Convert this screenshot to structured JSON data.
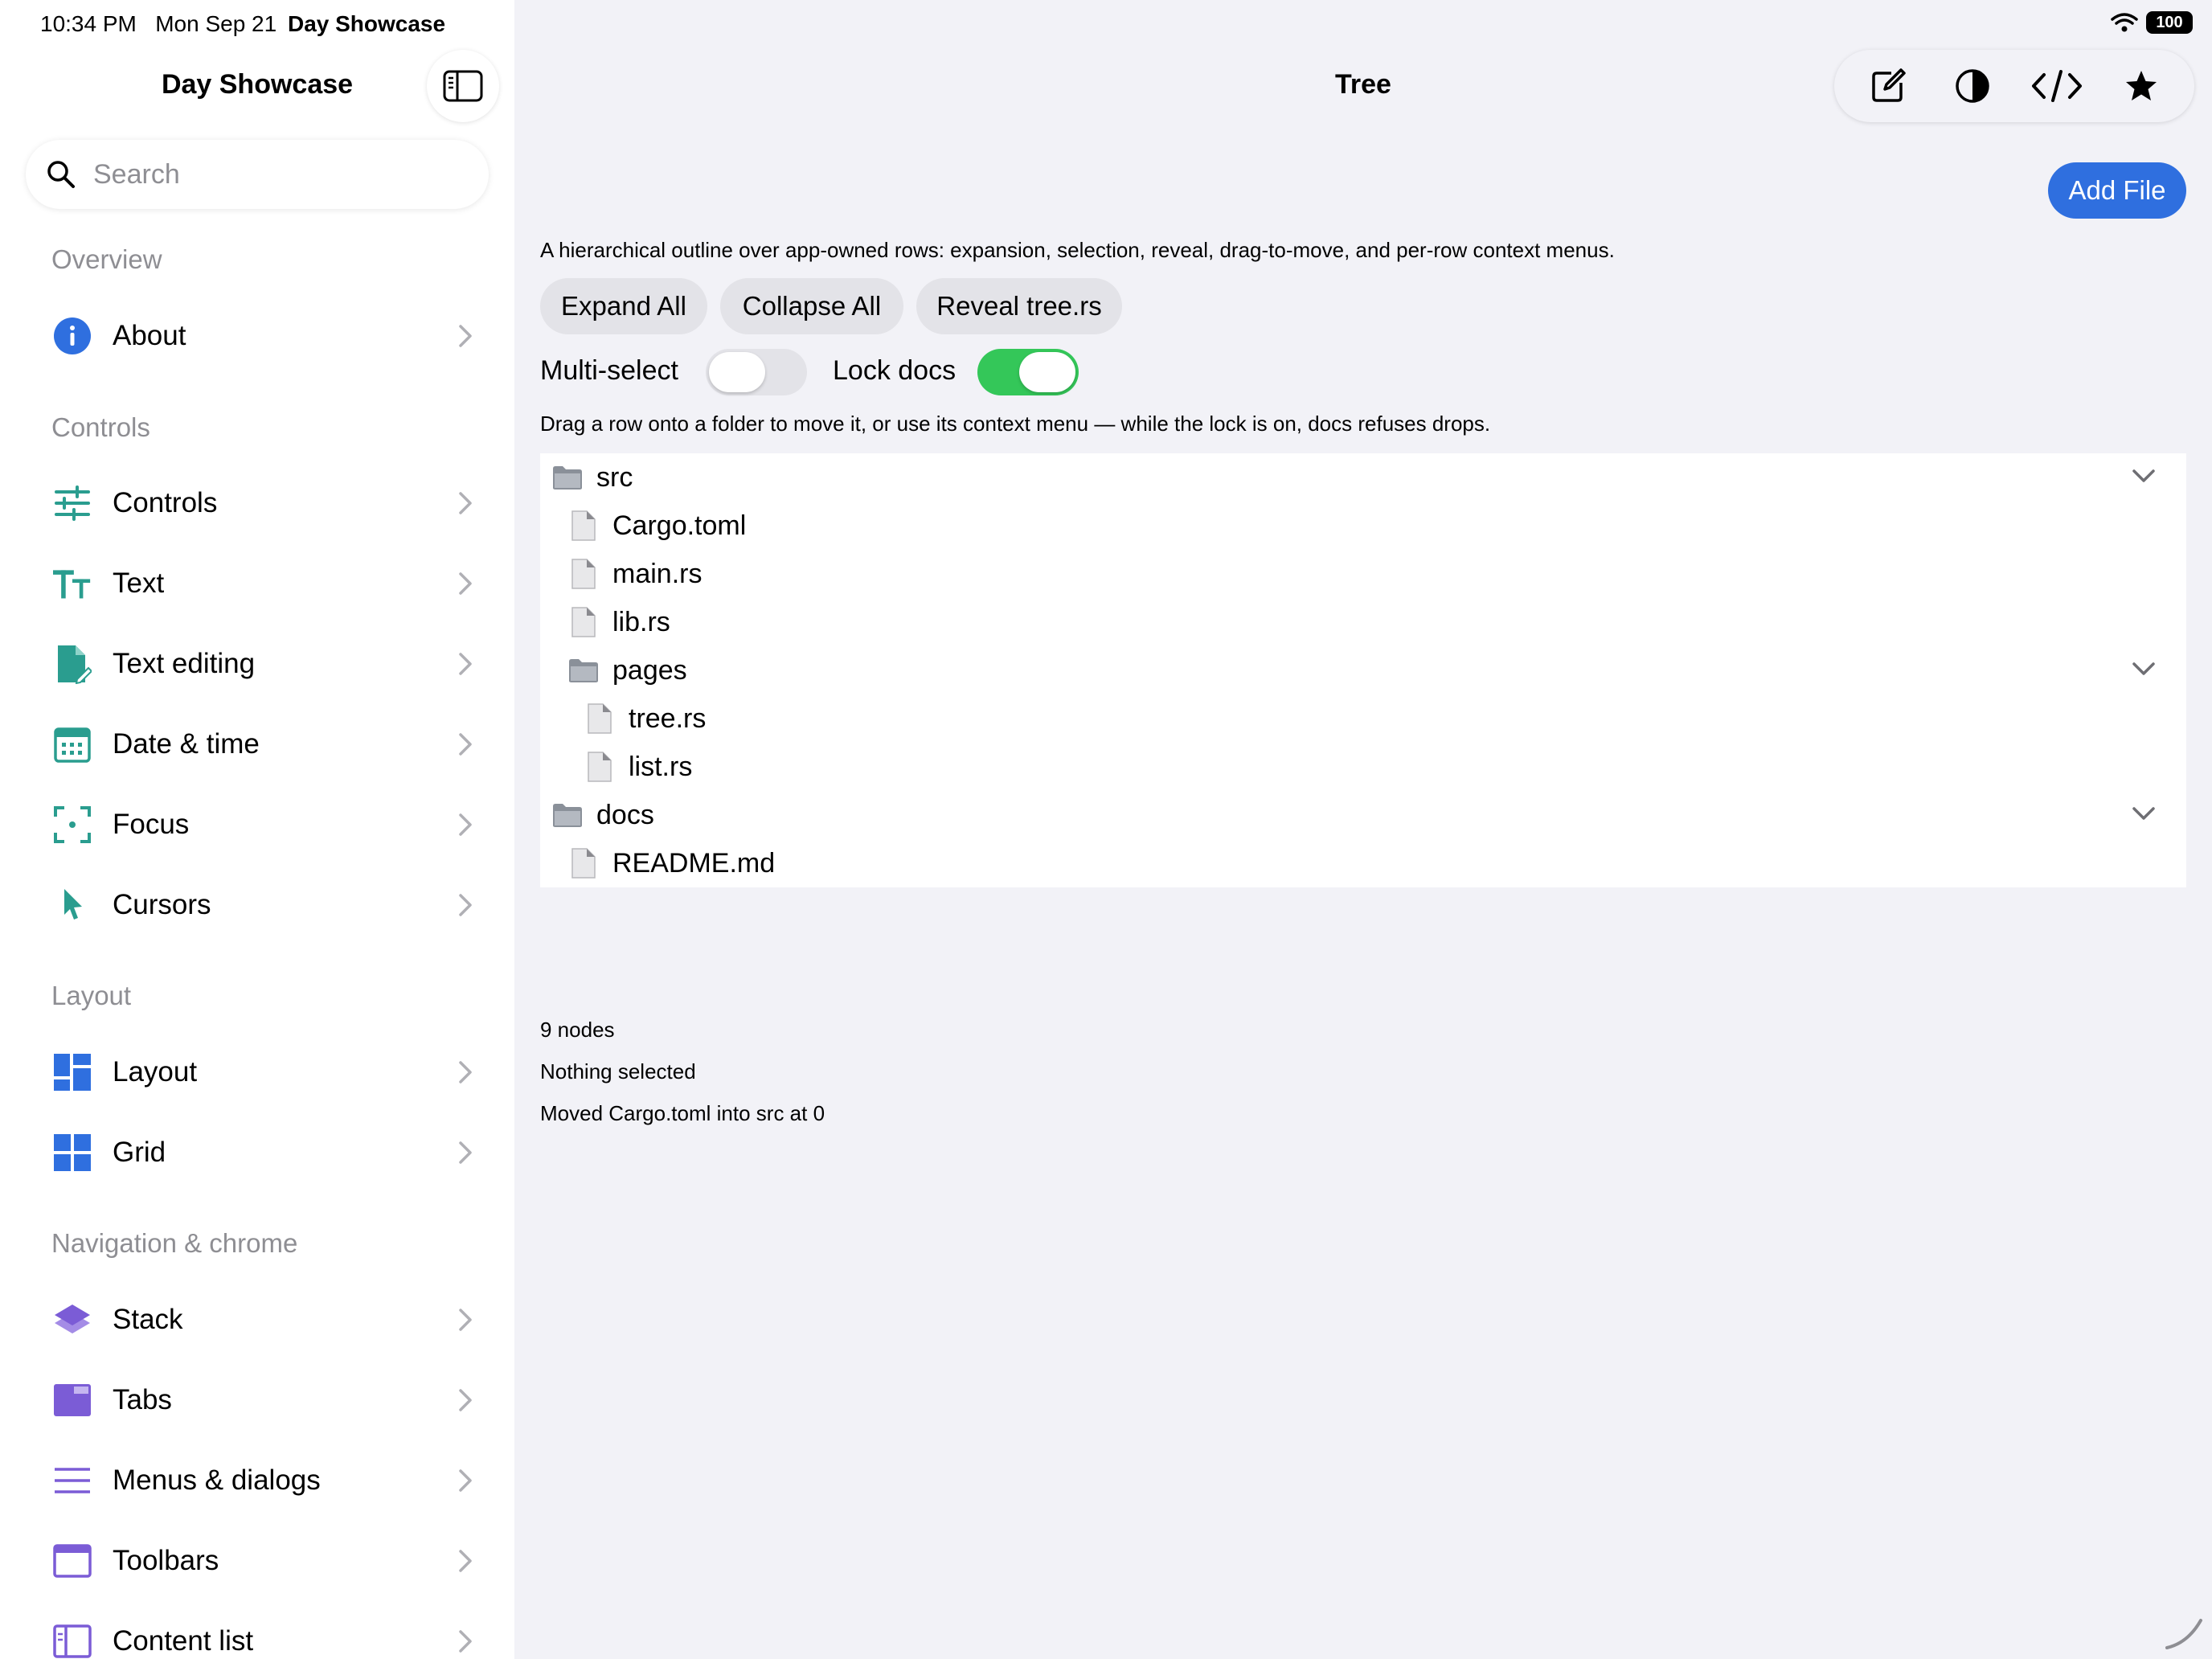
{
  "status": {
    "time": "10:34 PM",
    "date": "Mon Sep 21",
    "app": "Day Showcase",
    "battery": "100"
  },
  "sidebar": {
    "title": "Day Showcase",
    "search_placeholder": "Search",
    "sections": [
      {
        "header": "Overview",
        "items": [
          {
            "label": "About",
            "icon": "info-icon",
            "color": "#2f6fdf"
          }
        ]
      },
      {
        "header": "Controls",
        "items": [
          {
            "label": "Controls",
            "icon": "sliders-icon",
            "color": "#2a9d8f"
          },
          {
            "label": "Text",
            "icon": "text-size-icon",
            "color": "#2a9d8f"
          },
          {
            "label": "Text editing",
            "icon": "doc-edit-icon",
            "color": "#2a9d8f"
          },
          {
            "label": "Date & time",
            "icon": "calendar-icon",
            "color": "#2a9d8f"
          },
          {
            "label": "Focus",
            "icon": "focus-icon",
            "color": "#2a9d8f"
          },
          {
            "label": "Cursors",
            "icon": "cursor-icon",
            "color": "#2a9d8f"
          }
        ]
      },
      {
        "header": "Layout",
        "items": [
          {
            "label": "Layout",
            "icon": "layout-icon",
            "color": "#2f6fdf"
          },
          {
            "label": "Grid",
            "icon": "grid-icon",
            "color": "#2f6fdf"
          }
        ]
      },
      {
        "header": "Navigation & chrome",
        "items": [
          {
            "label": "Stack",
            "icon": "stack-icon",
            "color": "#7b5cd6"
          },
          {
            "label": "Tabs",
            "icon": "tabs-icon",
            "color": "#7b5cd6"
          },
          {
            "label": "Menus & dialogs",
            "icon": "menu-lines-icon",
            "color": "#7b5cd6"
          },
          {
            "label": "Toolbars",
            "icon": "toolbar-icon",
            "color": "#7b5cd6"
          },
          {
            "label": "Content list",
            "icon": "content-list-icon",
            "color": "#7b5cd6"
          }
        ]
      }
    ]
  },
  "main": {
    "title": "Tree",
    "add_file": "Add File",
    "description": "A hierarchical outline over app-owned rows: expansion, selection, reveal, drag-to-move, and per-row context menus.",
    "buttons": {
      "expand": "Expand All",
      "collapse": "Collapse All",
      "reveal": "Reveal tree.rs"
    },
    "toggles": {
      "multi_select": {
        "label": "Multi-select",
        "on": false
      },
      "lock_docs": {
        "label": "Lock docs",
        "on": true
      }
    },
    "hint": "Drag a row onto a folder to move it, or use its context menu — while the lock is on, docs refuses drops.",
    "tree": [
      {
        "label": "src",
        "kind": "folder",
        "depth": 0,
        "expanded": true
      },
      {
        "label": "Cargo.toml",
        "kind": "file",
        "depth": 1
      },
      {
        "label": "main.rs",
        "kind": "file",
        "depth": 1
      },
      {
        "label": "lib.rs",
        "kind": "file",
        "depth": 1
      },
      {
        "label": "pages",
        "kind": "folder",
        "depth": 1,
        "expanded": true
      },
      {
        "label": "tree.rs",
        "kind": "file",
        "depth": 2
      },
      {
        "label": "list.rs",
        "kind": "file",
        "depth": 2
      },
      {
        "label": "docs",
        "kind": "folder",
        "depth": 0,
        "expanded": true
      },
      {
        "label": "README.md",
        "kind": "file",
        "depth": 1
      }
    ],
    "stats": {
      "nodes": "9 nodes",
      "selection": "Nothing selected",
      "last_action": "Moved Cargo.toml into src at 0"
    }
  },
  "colors": {
    "accent": "#2f6fdf",
    "switch_on": "#34c759",
    "switch_off": "#e3e3e8"
  }
}
